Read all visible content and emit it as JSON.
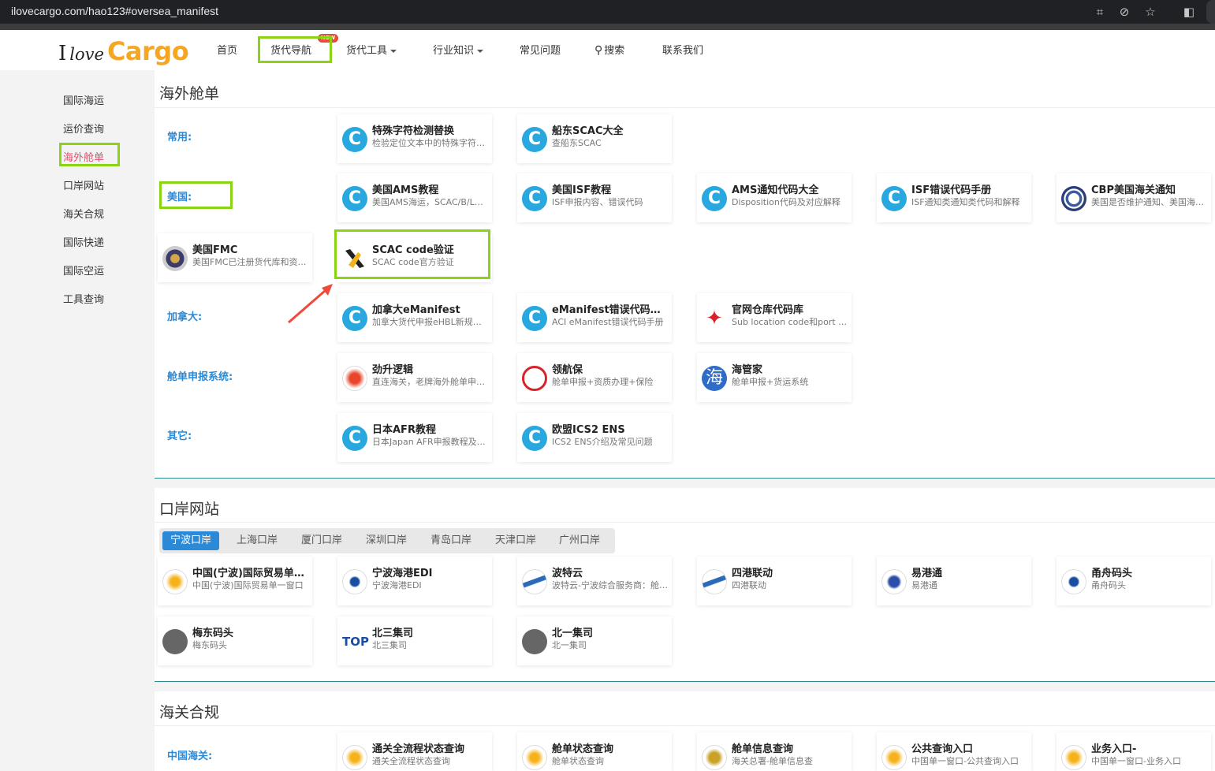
{
  "browser": {
    "url": "ilovecargo.com/hao123#oversea_manifest"
  },
  "logo": {
    "part1": "I",
    "part2": "love",
    "part3": "Cargo"
  },
  "nav": {
    "home": "首页",
    "forwarder_nav": "货代导航",
    "new_badge": "NEW",
    "tools": "货代工具",
    "knowledge": "行业知识",
    "faq": "常见问题",
    "search": "搜索",
    "contact": "联系我们"
  },
  "sidebar": {
    "items": [
      {
        "label": "国际海运"
      },
      {
        "label": "运价查询"
      },
      {
        "label": "海外舱单"
      },
      {
        "label": "口岸网站"
      },
      {
        "label": "海关合规"
      },
      {
        "label": "国际快递"
      },
      {
        "label": "国际空运"
      },
      {
        "label": "工具查询"
      }
    ]
  },
  "manifest": {
    "title": "海外舱单",
    "categories": {
      "common": "常用:",
      "usa": "美国:",
      "canada": "加拿大:",
      "system": "舱单申报系统:",
      "other": "其它:"
    },
    "cards": [
      {
        "title": "特殊字符检测替换",
        "desc": "检验定位文本中的特殊字符并替换",
        "icon": "c-icon"
      },
      {
        "title": "船东SCAC大全",
        "desc": "查船东SCAC",
        "icon": "c-icon"
      },
      {
        "title": "美国AMS教程",
        "desc": "美国AMS海运，SCAC/B/L号规则",
        "icon": "c-icon"
      },
      {
        "title": "美国ISF教程",
        "desc": "ISF申报内容、错误代码",
        "icon": "c-icon"
      },
      {
        "title": "AMS通知代码大全",
        "desc": "Disposition代码及对应解释",
        "icon": "c-icon"
      },
      {
        "title": "ISF错误代码手册",
        "desc": "ISF通知类通知类代码和解释",
        "icon": "c-icon"
      },
      {
        "title": "CBP美国海关通知",
        "desc": "美国是否维护通知、美国海关公告",
        "icon": "seal-icon"
      },
      {
        "title": "美国FMC",
        "desc": "美国FMC已注册货代库和资质查询",
        "icon": "fmc-seal-icon"
      },
      {
        "title": "SCAC code验证",
        "desc": "SCAC code官方验证",
        "icon": "scac-logo-icon"
      },
      {
        "title": "加拿大eManifest",
        "desc": "加拿大货代申报eHBL新规说明",
        "icon": "c-icon"
      },
      {
        "title": "eManifest错误代码手册",
        "desc": "ACI eManifest错误代码手册",
        "icon": "c-icon"
      },
      {
        "title": "官网仓库代码库",
        "desc": "Sub location code和port code",
        "icon": "maple-leaf-icon"
      },
      {
        "title": "劲升逻辑",
        "desc": "直连海关，老牌海外舱单申报服务",
        "icon": "phoenix-icon"
      },
      {
        "title": "领航保",
        "desc": "舱单申报+资质办理+保险",
        "icon": "red-ring-icon"
      },
      {
        "title": "海管家",
        "desc": "舱单申报+货运系统",
        "icon": "hai-icon"
      },
      {
        "title": "日本AFR教程",
        "desc": "日本Japan AFR申报教程及错误代码",
        "icon": "c-icon"
      },
      {
        "title": "欧盟ICS2 ENS",
        "desc": "ICS2 ENS介绍及常见问题",
        "icon": "c-icon"
      }
    ]
  },
  "ports": {
    "title": "口岸网站",
    "tabs": [
      "宁波口岸",
      "上海口岸",
      "厦门口岸",
      "深圳口岸",
      "青岛口岸",
      "天津口岸",
      "广州口岸"
    ],
    "cards": [
      {
        "title": "中国(宁波)国际贸易单一窗口",
        "desc": "中国(宁波)国际贸易单一窗口",
        "icon": "edge-icon"
      },
      {
        "title": "宁波海港EDI",
        "desc": "宁波海港EDI",
        "icon": "port-logo-icon"
      },
      {
        "title": "波特云",
        "desc": "波特云-宁波综合服务商：舱单报文",
        "icon": "wave-icon"
      },
      {
        "title": "四港联动",
        "desc": "四港联动",
        "icon": "wave-icon"
      },
      {
        "title": "易港通",
        "desc": "易港通",
        "icon": "mascot-icon"
      },
      {
        "title": "甬舟码头",
        "desc": "甬舟码头",
        "icon": "port-logo-icon"
      },
      {
        "title": "梅东码头",
        "desc": "梅东码头",
        "icon": "globe-icon"
      },
      {
        "title": "北三集司",
        "desc": "北三集司",
        "icon": "top-logo-icon"
      },
      {
        "title": "北一集司",
        "desc": "北一集司",
        "icon": "globe-icon"
      }
    ]
  },
  "customs": {
    "title": "海关合规",
    "categories": {
      "china": "中国海关:"
    },
    "cards": [
      {
        "title": "通关全流程状态查询",
        "desc": "通关全流程状态查询",
        "icon": "edge-icon"
      },
      {
        "title": "舱单状态查询",
        "desc": "舱单状态查询",
        "icon": "edge-icon"
      },
      {
        "title": "舱单信息查询",
        "desc": "海关总署-舱单信息查",
        "icon": "emblem-icon"
      },
      {
        "title": "公共查询入口",
        "desc": "中国单一窗口-公共查询入口",
        "icon": "edge-icon"
      },
      {
        "title": "业务入口-",
        "desc": "中国单一窗口-业务入口",
        "icon": "edge-icon"
      }
    ]
  },
  "colors": {
    "accent": "#2a8ad8",
    "active_sidebar": "#e74c6c",
    "highlight_box": "#8bd414",
    "logo_orange": "#f5a623",
    "arrow": "#f04a3c"
  }
}
